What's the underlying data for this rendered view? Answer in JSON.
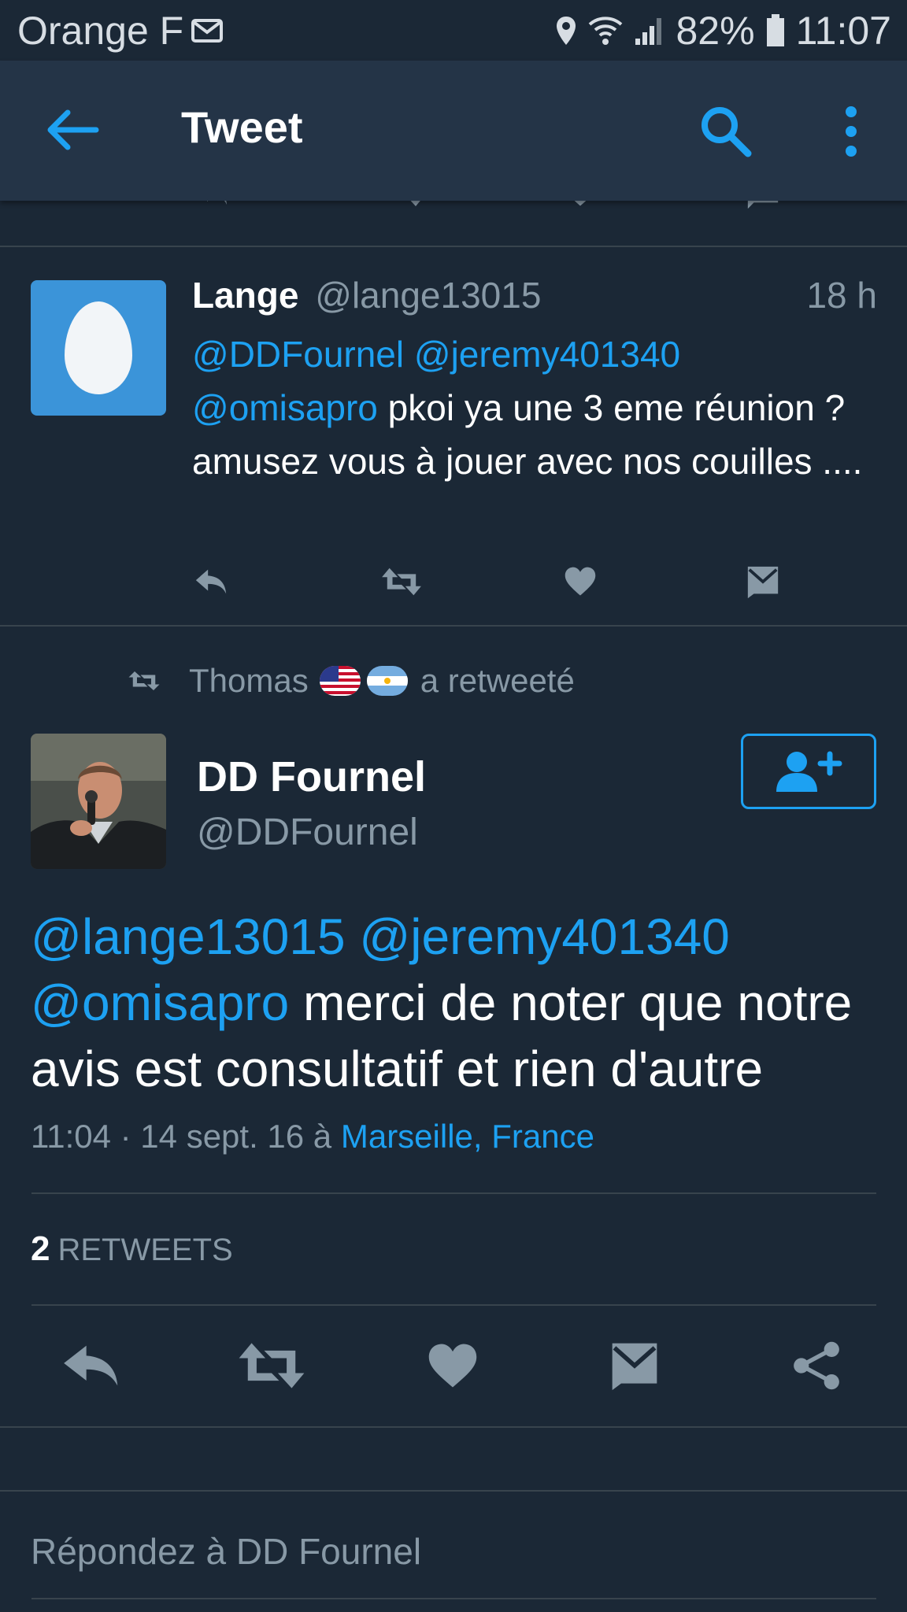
{
  "status_bar": {
    "carrier": "Orange F",
    "battery": "82%",
    "time": "11:07",
    "icons": [
      "mail-icon",
      "location-icon",
      "wifi-icon",
      "signal-icon",
      "battery-icon"
    ]
  },
  "app_bar": {
    "title": "Tweet",
    "icons": [
      "back-arrow-icon",
      "search-icon",
      "more-vert-icon"
    ]
  },
  "reply_tweet": {
    "name": "Lange",
    "handle": "@lange13015",
    "time": "18 h",
    "mentions": [
      "@DDFournel",
      "@jeremy401340",
      "@omisapro"
    ],
    "text": " pkoi ya une 3 eme réunion ?amusez vous à jouer avec nos couilles ....",
    "actions": [
      "reply-icon",
      "retweet-icon",
      "like-icon",
      "direct-message-icon"
    ]
  },
  "retweeted_by": {
    "name": "Thomas",
    "flags": [
      "flag-us",
      "flag-argentina"
    ],
    "suffix": "a retweeté"
  },
  "main_tweet": {
    "name": "DD Fournel",
    "handle": "@DDFournel",
    "mentions": [
      "@lange13015",
      "@jeremy401340",
      "@omisapro"
    ],
    "text": " merci de noter que notre avis est consultatif et rien d'autre",
    "timestamp": "11:04 · 14 sept. 16 à",
    "location": "Marseille, France",
    "retweet_count": "2",
    "retweet_label": "RETWEETS",
    "actions": [
      "reply-icon",
      "retweet-icon",
      "like-icon",
      "direct-message-icon",
      "share-icon"
    ]
  },
  "reply_input": {
    "placeholder": "Répondez à DD Fournel"
  },
  "colors": {
    "background": "#1b2836",
    "app_bar": "#243447",
    "accent": "#1da1f2",
    "muted": "#8899a6",
    "divider": "#38444d"
  }
}
